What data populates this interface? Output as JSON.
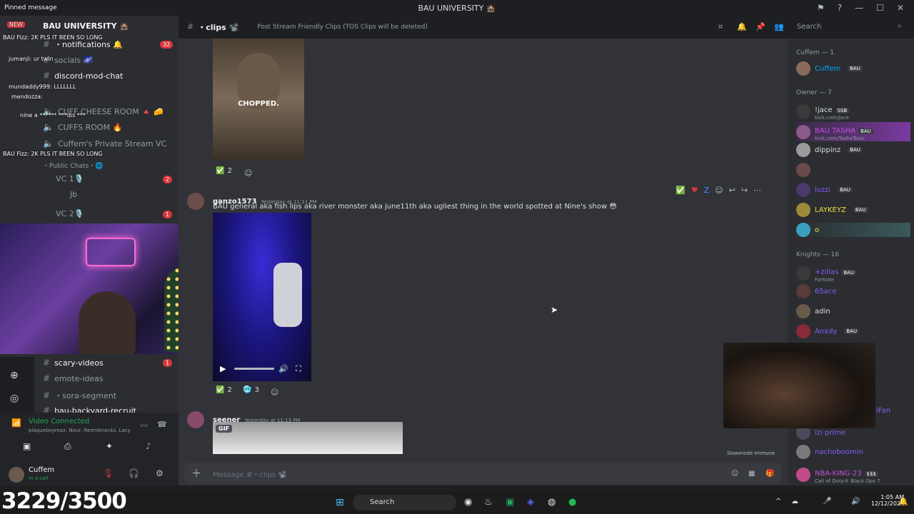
{
  "window": {
    "title": "BAU UNIVERSITY 🏚️"
  },
  "overlay": {
    "pinned": "Pinned message",
    "chat_lines": [
      "BAU Fizz: 2K PLS IT BEEN SO LONG",
      "jumanji: ur twin",
      "mundaddy999: LLLLLLL",
      "mendozza:",
      "nine a ****** ***dis ***",
      "BAU Fizz: 2K PLS IT BEEN SO LONG"
    ],
    "badge_new": "NEW"
  },
  "sidebar": {
    "guild_name": "BAU UNIVERSITY 🏚️",
    "channels": [
      {
        "label": "・notifications 🔔",
        "badge": "32"
      },
      {
        "label": "socials 🌌",
        "badge": ""
      },
      {
        "label": "discord-mod-chat",
        "badge": ""
      },
      {
        "label": "CUFF CHEESE ROOM 🔺 🧀",
        "badge": ""
      },
      {
        "label": "CUFFS ROOM 🔥",
        "badge": ""
      },
      {
        "label": "Cuffem's Private Stream VC",
        "badge": ""
      },
      {
        "label": "・Public Chats・🌐",
        "badge": ""
      },
      {
        "label": "VC 1🎙️",
        "badge": "2"
      },
      {
        "label": "Jb",
        "badge": ""
      },
      {
        "label": "VC 2🎙️",
        "badge": "1"
      },
      {
        "label": "scary-videos",
        "badge": "1"
      },
      {
        "label": "emote-ideas",
        "badge": ""
      },
      {
        "label": "・sora-segment",
        "badge": ""
      },
      {
        "label": "bau-backyard-recruit",
        "badge": ""
      }
    ]
  },
  "voice": {
    "status": "Video Connected",
    "participants": "plaqueboymax, Nour, Reemknocks, Lacy",
    "user": "Cuffem",
    "user_status": "In a call"
  },
  "chat_header": {
    "channel": "・clips 📽️",
    "topic": "Post Stream Friendly Clips (TOS Clips will be deleted)"
  },
  "search": {
    "placeholder": "Search"
  },
  "messages": [
    {
      "author": "",
      "time": "",
      "text": "",
      "image_caption": "CHOPPED.",
      "reactions": [
        {
          "emoji": "✅",
          "count": "2"
        }
      ]
    },
    {
      "author": "ganzo1573",
      "time": "Yesterday at 11:11 PM",
      "text": "BAU general aka fish lips aka river monster aka june11th aka ugliest thing in the world spotted at Nine's show 😳",
      "reactions": [
        {
          "emoji": "✅",
          "count": "2"
        },
        {
          "emoji": "🥶",
          "count": "3"
        }
      ]
    },
    {
      "author": "seener",
      "time": "Yesterday at 11:13 PM",
      "text": "",
      "gif_label": "GIF",
      "reactions": []
    }
  ],
  "slowmode": "Slowmode Immune",
  "input": {
    "placeholder": "Message #・clips 📽️"
  },
  "members": {
    "groups": [
      {
        "title": "Cuffem — 1",
        "members": [
          {
            "name": "Cuffem",
            "tag": "BAU",
            "sub": "",
            "color": "#00a8fc"
          }
        ]
      },
      {
        "title": "Owner — 7",
        "members": [
          {
            "name": "!jace",
            "tag": "SSB",
            "sub": "kick.com/jace",
            "color": "#ffffff"
          },
          {
            "name": "BAU TASHA",
            "tag": "BAU",
            "sub": "kick.com/TashaToxic",
            "color": "#c24fe0"
          },
          {
            "name": "dippinz",
            "tag": "BAU",
            "sub": "",
            "color": "#ffffff"
          },
          {
            "name": "",
            "tag": "",
            "sub": "",
            "color": "#ffffff"
          },
          {
            "name": "lozzi",
            "tag": "BAU",
            "sub": "",
            "color": "#8a5cf5"
          },
          {
            "name": "LAYKEYZ",
            "tag": "BAU",
            "sub": "",
            "color": "#f0e040"
          },
          {
            "name": "o",
            "tag": "",
            "sub": "",
            "color": "#f0e040"
          }
        ]
      },
      {
        "title": "Knights — 16",
        "members": [
          {
            "name": "+zillas",
            "tag": "BAU",
            "sub": "Fortnite",
            "color": "#8a5cf5"
          },
          {
            "name": "65ace",
            "tag": "",
            "sub": "",
            "color": "#8a5cf5"
          },
          {
            "name": "adin",
            "tag": "",
            "sub": "",
            "color": "#ffffff"
          },
          {
            "name": "Anxdy",
            "tag": "BAU",
            "sub": "",
            "color": "#8a5cf5"
          },
          {
            "name": "lFan",
            "tag": "",
            "sub": "",
            "color": "#8a5cf5"
          },
          {
            "name": "izi prime",
            "tag": "",
            "sub": "",
            "color": "#8a5cf5"
          },
          {
            "name": "nachoboomin",
            "tag": "",
            "sub": "",
            "color": "#8a5cf5"
          },
          {
            "name": "NBA-KING-23",
            "tag": "$$$",
            "sub": "Call of Duty® Black Ops 7",
            "color": "#c24fe0"
          }
        ]
      }
    ]
  },
  "taskbar": {
    "search": "Search",
    "time": "1:05 AM",
    "date": "12/12/2025"
  },
  "counter": "3229/3500"
}
